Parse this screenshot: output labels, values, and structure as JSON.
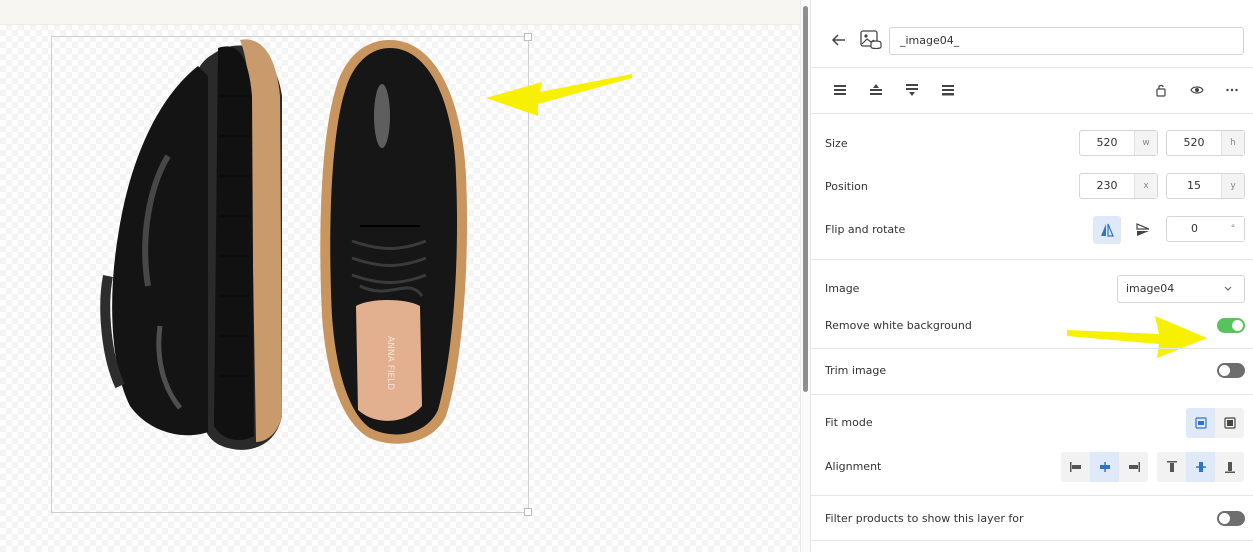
{
  "panel": {
    "name_value": "_image04_",
    "size": {
      "label": "Size",
      "width": "520",
      "width_unit": "w",
      "height": "520",
      "height_unit": "h"
    },
    "position": {
      "label": "Position",
      "x": "230",
      "x_unit": "x",
      "y": "15",
      "y_unit": "y"
    },
    "flip_rotate": {
      "label": "Flip and rotate",
      "rotation": "0",
      "rotation_unit": "°"
    },
    "image": {
      "label": "Image",
      "selected": "image04"
    },
    "remove_white_bg": {
      "label": "Remove white background",
      "on": true
    },
    "trim_image": {
      "label": "Trim image",
      "on": false
    },
    "fit_mode": {
      "label": "Fit mode"
    },
    "alignment": {
      "label": "Alignment"
    },
    "filter_products": {
      "label": "Filter products to show this layer for",
      "on": false
    }
  },
  "canvas": {
    "insole_brand_text": "ANNA FIELD"
  },
  "colors": {
    "accent": "#2f73c9",
    "toggle_on": "#58c35c",
    "arrow": "#f7f000"
  }
}
